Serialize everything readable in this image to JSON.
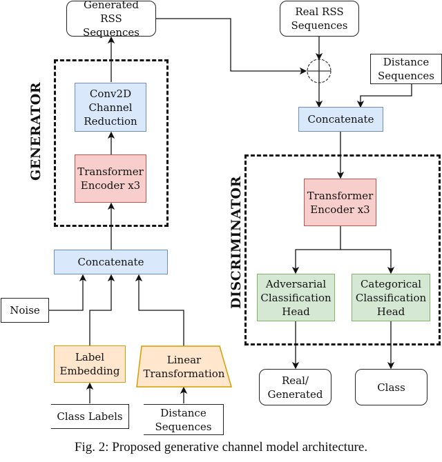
{
  "generator": {
    "group_label": "GENERATOR",
    "output": "Generated RSS Sequences",
    "conv": "Conv2D Channel Reduction",
    "encoder": "Transformer Encoder x3",
    "concat": "Concatenate",
    "noise": "Noise",
    "label_embedding": "Label Embedding",
    "linear_transformation": "Linear Transformation",
    "class_labels": "Class Labels",
    "distance_sequences": "Distance Sequences"
  },
  "discriminator": {
    "group_label": "DISCRIMINATOR",
    "real_rss": "Real RSS Sequences",
    "distance_sequences": "Distance Sequences",
    "concat": "Concatenate",
    "encoder": "Transformer Encoder x3",
    "adversarial_head": "Adversarial Classification Head",
    "categorical_head": "Categorical Classification Head",
    "real_generated": "Real/ Generated",
    "class": "Class"
  },
  "colors": {
    "blue_fill": "#dae8fc",
    "red_fill": "#f8cecc",
    "green_fill": "#d5e8d4",
    "orange_fill": "#ffe6cc"
  },
  "caption": "Fig. 2: Proposed generative channel model architecture."
}
